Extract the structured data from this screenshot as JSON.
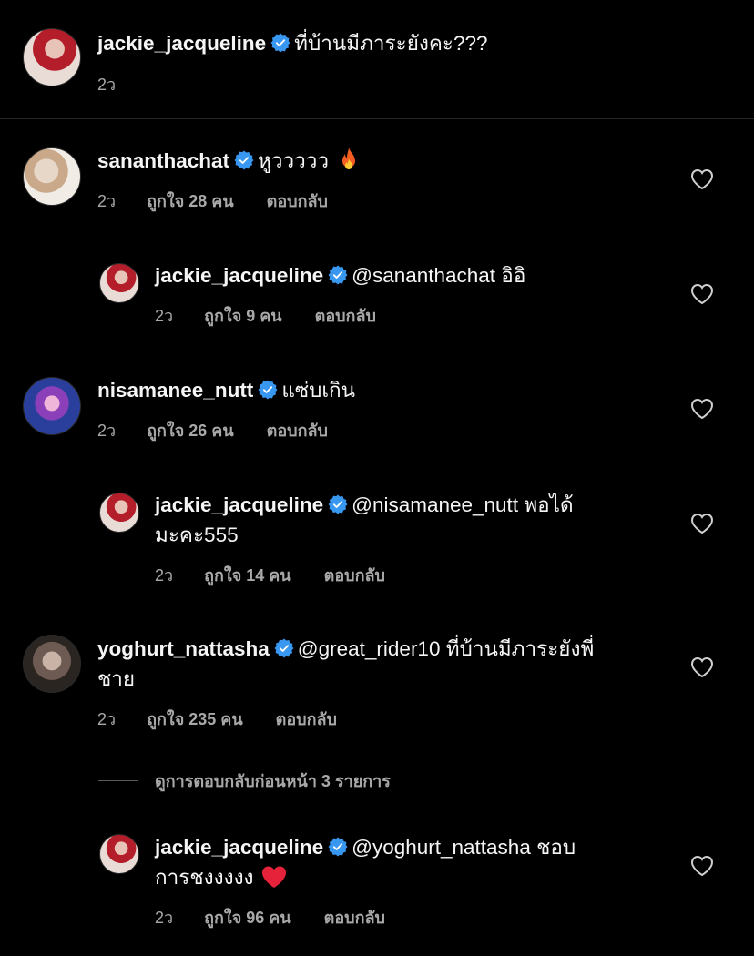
{
  "caption": {
    "username": "jackie_jacqueline",
    "text": "ที่บ้านมีภาระยังคะ???",
    "time": "2ว"
  },
  "comments": [
    {
      "username": "sananthachat",
      "text": "หูววววว",
      "emoji": "fire",
      "time": "2ว",
      "likes": "ถูกใจ 28 คน",
      "reply": "ตอบกลับ"
    },
    {
      "username": "jackie_jacqueline",
      "text_line1": "@sananthachat อิอิ",
      "time": "2ว",
      "likes": "ถูกใจ 9 คน",
      "reply": "ตอบกลับ"
    },
    {
      "username": "nisamanee_nutt",
      "text": "แซ่บเกิน",
      "time": "2ว",
      "likes": "ถูกใจ 26 คน",
      "reply": "ตอบกลับ"
    },
    {
      "username": "jackie_jacqueline",
      "text_line1": "@nisamanee_nutt พอได้",
      "text_line2": "มะคะ555",
      "time": "2ว",
      "likes": "ถูกใจ 14 คน",
      "reply": "ตอบกลับ"
    },
    {
      "username": "yoghurt_nattasha",
      "text_line1": "@great_rider10 ที่บ้านมีภาระยังพี่",
      "text_line2": "ชาย",
      "time": "2ว",
      "likes": "ถูกใจ 235 คน",
      "reply": "ตอบกลับ"
    },
    {
      "username": "jackie_jacqueline",
      "text_line1": "@yoghurt_nattasha ชอบ",
      "text_line2": "การชงงงงง",
      "emoji": "red-heart",
      "time": "2ว",
      "likes": "ถูกใจ 96 คน",
      "reply": "ตอบกลับ"
    }
  ],
  "view_previous": "ดูการตอบกลับก่อนหน้า 3 รายการ",
  "colors": {
    "background": "#000000",
    "verified": "#3897f0",
    "secondary": "#a8a8a8"
  },
  "icons": [
    "verified-badge-icon",
    "heart-outline-icon",
    "fire-emoji",
    "red-heart-emoji"
  ]
}
